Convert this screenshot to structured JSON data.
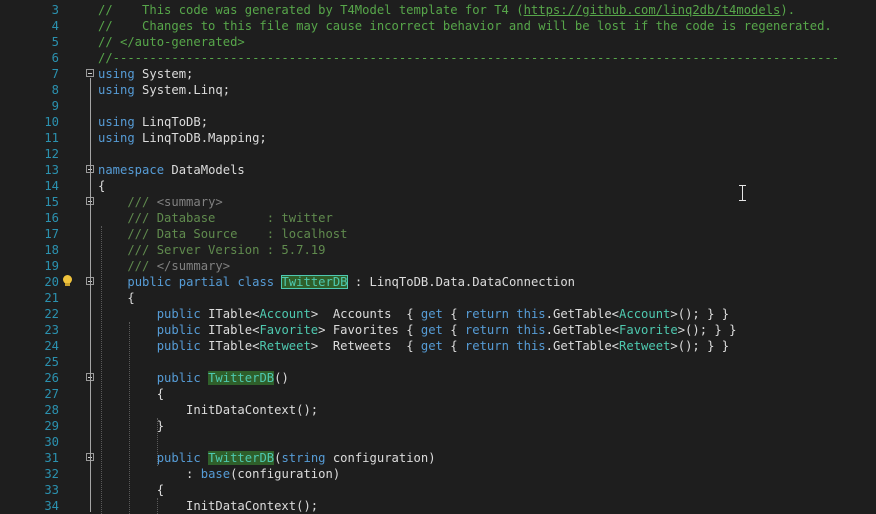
{
  "editor": {
    "language": "C#",
    "colors": {
      "background": "#1e1e1e",
      "line_number": "#2b91af",
      "comment": "#57a64a",
      "keyword": "#569cd6",
      "type": "#4ec9b0",
      "text": "#dcdcdc",
      "highlight": "#2f5f2a"
    },
    "lines": [
      {
        "n": "3",
        "fold": false,
        "bulb": false,
        "tokens": [
          {
            "t": "//    This code was generated by T4Model template for T4 (",
            "c": "comment"
          },
          {
            "t": "https://github.com/linq2db/t4models",
            "c": "link"
          },
          {
            "t": ").",
            "c": "comment"
          }
        ]
      },
      {
        "n": "4",
        "fold": false,
        "bulb": false,
        "tokens": [
          {
            "t": "//    Changes to this file may cause incorrect behavior and will be lost if the code is regenerated.",
            "c": "comment"
          }
        ]
      },
      {
        "n": "5",
        "fold": false,
        "bulb": false,
        "tokens": [
          {
            "t": "// </auto-generated>",
            "c": "comment"
          }
        ]
      },
      {
        "n": "6",
        "fold": false,
        "bulb": false,
        "tokens": [
          {
            "t": "//---------------------------------------------------------------------------------------------------",
            "c": "comment"
          }
        ]
      },
      {
        "n": "7",
        "fold": true,
        "bulb": false,
        "tokens": [
          {
            "t": "using",
            "c": "kw"
          },
          {
            "t": " System;",
            "c": "plain"
          }
        ]
      },
      {
        "n": "8",
        "fold": false,
        "bulb": false,
        "tokens": [
          {
            "t": "using",
            "c": "kw"
          },
          {
            "t": " System.Linq;",
            "c": "plain"
          }
        ]
      },
      {
        "n": "9",
        "fold": false,
        "bulb": false,
        "tokens": []
      },
      {
        "n": "10",
        "fold": false,
        "bulb": false,
        "tokens": [
          {
            "t": "using",
            "c": "kw"
          },
          {
            "t": " LinqToDB;",
            "c": "plain"
          }
        ]
      },
      {
        "n": "11",
        "fold": false,
        "bulb": false,
        "tokens": [
          {
            "t": "using",
            "c": "kw"
          },
          {
            "t": " LinqToDB.Mapping;",
            "c": "plain"
          }
        ]
      },
      {
        "n": "12",
        "fold": false,
        "bulb": false,
        "tokens": []
      },
      {
        "n": "13",
        "fold": true,
        "bulb": false,
        "tokens": [
          {
            "t": "namespace",
            "c": "kw"
          },
          {
            "t": " DataModels",
            "c": "plain"
          }
        ]
      },
      {
        "n": "14",
        "fold": false,
        "bulb": false,
        "tokens": [
          {
            "t": "{",
            "c": "plain"
          }
        ]
      },
      {
        "n": "15",
        "fold": true,
        "bulb": false,
        "tokens": [
          {
            "t": "    /// ",
            "c": "doc"
          },
          {
            "t": "<summary>",
            "c": "docx"
          }
        ]
      },
      {
        "n": "16",
        "fold": false,
        "bulb": false,
        "tokens": [
          {
            "t": "    /// Database       : twitter",
            "c": "doc"
          }
        ]
      },
      {
        "n": "17",
        "fold": false,
        "bulb": false,
        "tokens": [
          {
            "t": "    /// Data Source    : localhost",
            "c": "doc"
          }
        ]
      },
      {
        "n": "18",
        "fold": false,
        "bulb": false,
        "tokens": [
          {
            "t": "    /// Server Version : 5.7.19",
            "c": "doc"
          }
        ]
      },
      {
        "n": "19",
        "fold": false,
        "bulb": false,
        "tokens": [
          {
            "t": "    /// ",
            "c": "doc"
          },
          {
            "t": "</summary>",
            "c": "docx"
          }
        ]
      },
      {
        "n": "20",
        "fold": true,
        "bulb": true,
        "tokens": [
          {
            "t": "    ",
            "c": "plain"
          },
          {
            "t": "public",
            "c": "kw"
          },
          {
            "t": " ",
            "c": "plain"
          },
          {
            "t": "partial",
            "c": "kw"
          },
          {
            "t": " ",
            "c": "plain"
          },
          {
            "t": "class",
            "c": "kw"
          },
          {
            "t": " ",
            "c": "plain"
          },
          {
            "t": "TwitterDB",
            "c": "hlbox"
          },
          {
            "t": " : LinqToDB.Data.DataConnection",
            "c": "plain"
          }
        ]
      },
      {
        "n": "21",
        "fold": false,
        "bulb": false,
        "tokens": [
          {
            "t": "    {",
            "c": "plain"
          }
        ]
      },
      {
        "n": "22",
        "fold": false,
        "bulb": false,
        "tokens": [
          {
            "t": "        ",
            "c": "plain"
          },
          {
            "t": "public",
            "c": "kw"
          },
          {
            "t": " ITable<",
            "c": "plain"
          },
          {
            "t": "Account",
            "c": "type"
          },
          {
            "t": ">  Accounts  { ",
            "c": "plain"
          },
          {
            "t": "get",
            "c": "kw"
          },
          {
            "t": " { ",
            "c": "plain"
          },
          {
            "t": "return",
            "c": "kw"
          },
          {
            "t": " ",
            "c": "plain"
          },
          {
            "t": "this",
            "c": "kw"
          },
          {
            "t": ".GetTable<",
            "c": "plain"
          },
          {
            "t": "Account",
            "c": "type"
          },
          {
            "t": ">(); } }",
            "c": "plain"
          }
        ]
      },
      {
        "n": "23",
        "fold": false,
        "bulb": false,
        "tokens": [
          {
            "t": "        ",
            "c": "plain"
          },
          {
            "t": "public",
            "c": "kw"
          },
          {
            "t": " ITable<",
            "c": "plain"
          },
          {
            "t": "Favorite",
            "c": "type"
          },
          {
            "t": "> Favorites { ",
            "c": "plain"
          },
          {
            "t": "get",
            "c": "kw"
          },
          {
            "t": " { ",
            "c": "plain"
          },
          {
            "t": "return",
            "c": "kw"
          },
          {
            "t": " ",
            "c": "plain"
          },
          {
            "t": "this",
            "c": "kw"
          },
          {
            "t": ".GetTable<",
            "c": "plain"
          },
          {
            "t": "Favorite",
            "c": "type"
          },
          {
            "t": ">(); } }",
            "c": "plain"
          }
        ]
      },
      {
        "n": "24",
        "fold": false,
        "bulb": false,
        "tokens": [
          {
            "t": "        ",
            "c": "plain"
          },
          {
            "t": "public",
            "c": "kw"
          },
          {
            "t": " ITable<",
            "c": "plain"
          },
          {
            "t": "Retweet",
            "c": "type"
          },
          {
            "t": ">  Retweets  { ",
            "c": "plain"
          },
          {
            "t": "get",
            "c": "kw"
          },
          {
            "t": " { ",
            "c": "plain"
          },
          {
            "t": "return",
            "c": "kw"
          },
          {
            "t": " ",
            "c": "plain"
          },
          {
            "t": "this",
            "c": "kw"
          },
          {
            "t": ".GetTable<",
            "c": "plain"
          },
          {
            "t": "Retweet",
            "c": "type"
          },
          {
            "t": ">(); } }",
            "c": "plain"
          }
        ]
      },
      {
        "n": "25",
        "fold": false,
        "bulb": false,
        "tokens": []
      },
      {
        "n": "26",
        "fold": true,
        "bulb": false,
        "tokens": [
          {
            "t": "        ",
            "c": "plain"
          },
          {
            "t": "public",
            "c": "kw"
          },
          {
            "t": " ",
            "c": "plain"
          },
          {
            "t": "TwitterDB",
            "c": "hl"
          },
          {
            "t": "()",
            "c": "plain"
          }
        ]
      },
      {
        "n": "27",
        "fold": false,
        "bulb": false,
        "tokens": [
          {
            "t": "        {",
            "c": "plain"
          }
        ]
      },
      {
        "n": "28",
        "fold": false,
        "bulb": false,
        "tokens": [
          {
            "t": "            InitDataContext();",
            "c": "plain"
          }
        ]
      },
      {
        "n": "29",
        "fold": false,
        "bulb": false,
        "tokens": [
          {
            "t": "        }",
            "c": "plain"
          }
        ]
      },
      {
        "n": "30",
        "fold": false,
        "bulb": false,
        "tokens": []
      },
      {
        "n": "31",
        "fold": true,
        "bulb": false,
        "tokens": [
          {
            "t": "        ",
            "c": "plain"
          },
          {
            "t": "public",
            "c": "kw"
          },
          {
            "t": " ",
            "c": "plain"
          },
          {
            "t": "TwitterDB",
            "c": "hl"
          },
          {
            "t": "(",
            "c": "plain"
          },
          {
            "t": "string",
            "c": "kw"
          },
          {
            "t": " configuration)",
            "c": "plain"
          }
        ]
      },
      {
        "n": "32",
        "fold": false,
        "bulb": false,
        "tokens": [
          {
            "t": "            : ",
            "c": "plain"
          },
          {
            "t": "base",
            "c": "kw"
          },
          {
            "t": "(configuration)",
            "c": "plain"
          }
        ]
      },
      {
        "n": "33",
        "fold": false,
        "bulb": false,
        "tokens": [
          {
            "t": "        {",
            "c": "plain"
          }
        ]
      },
      {
        "n": "34",
        "fold": false,
        "bulb": false,
        "tokens": [
          {
            "t": "            InitDataContext();",
            "c": "plain"
          }
        ]
      }
    ]
  },
  "mouse_cursor": {
    "icon": "text-ibeam-cursor-icon"
  },
  "lightbulb": {
    "icon": "lightbulb-icon"
  },
  "fold_icon": "collapse-minus-icon"
}
